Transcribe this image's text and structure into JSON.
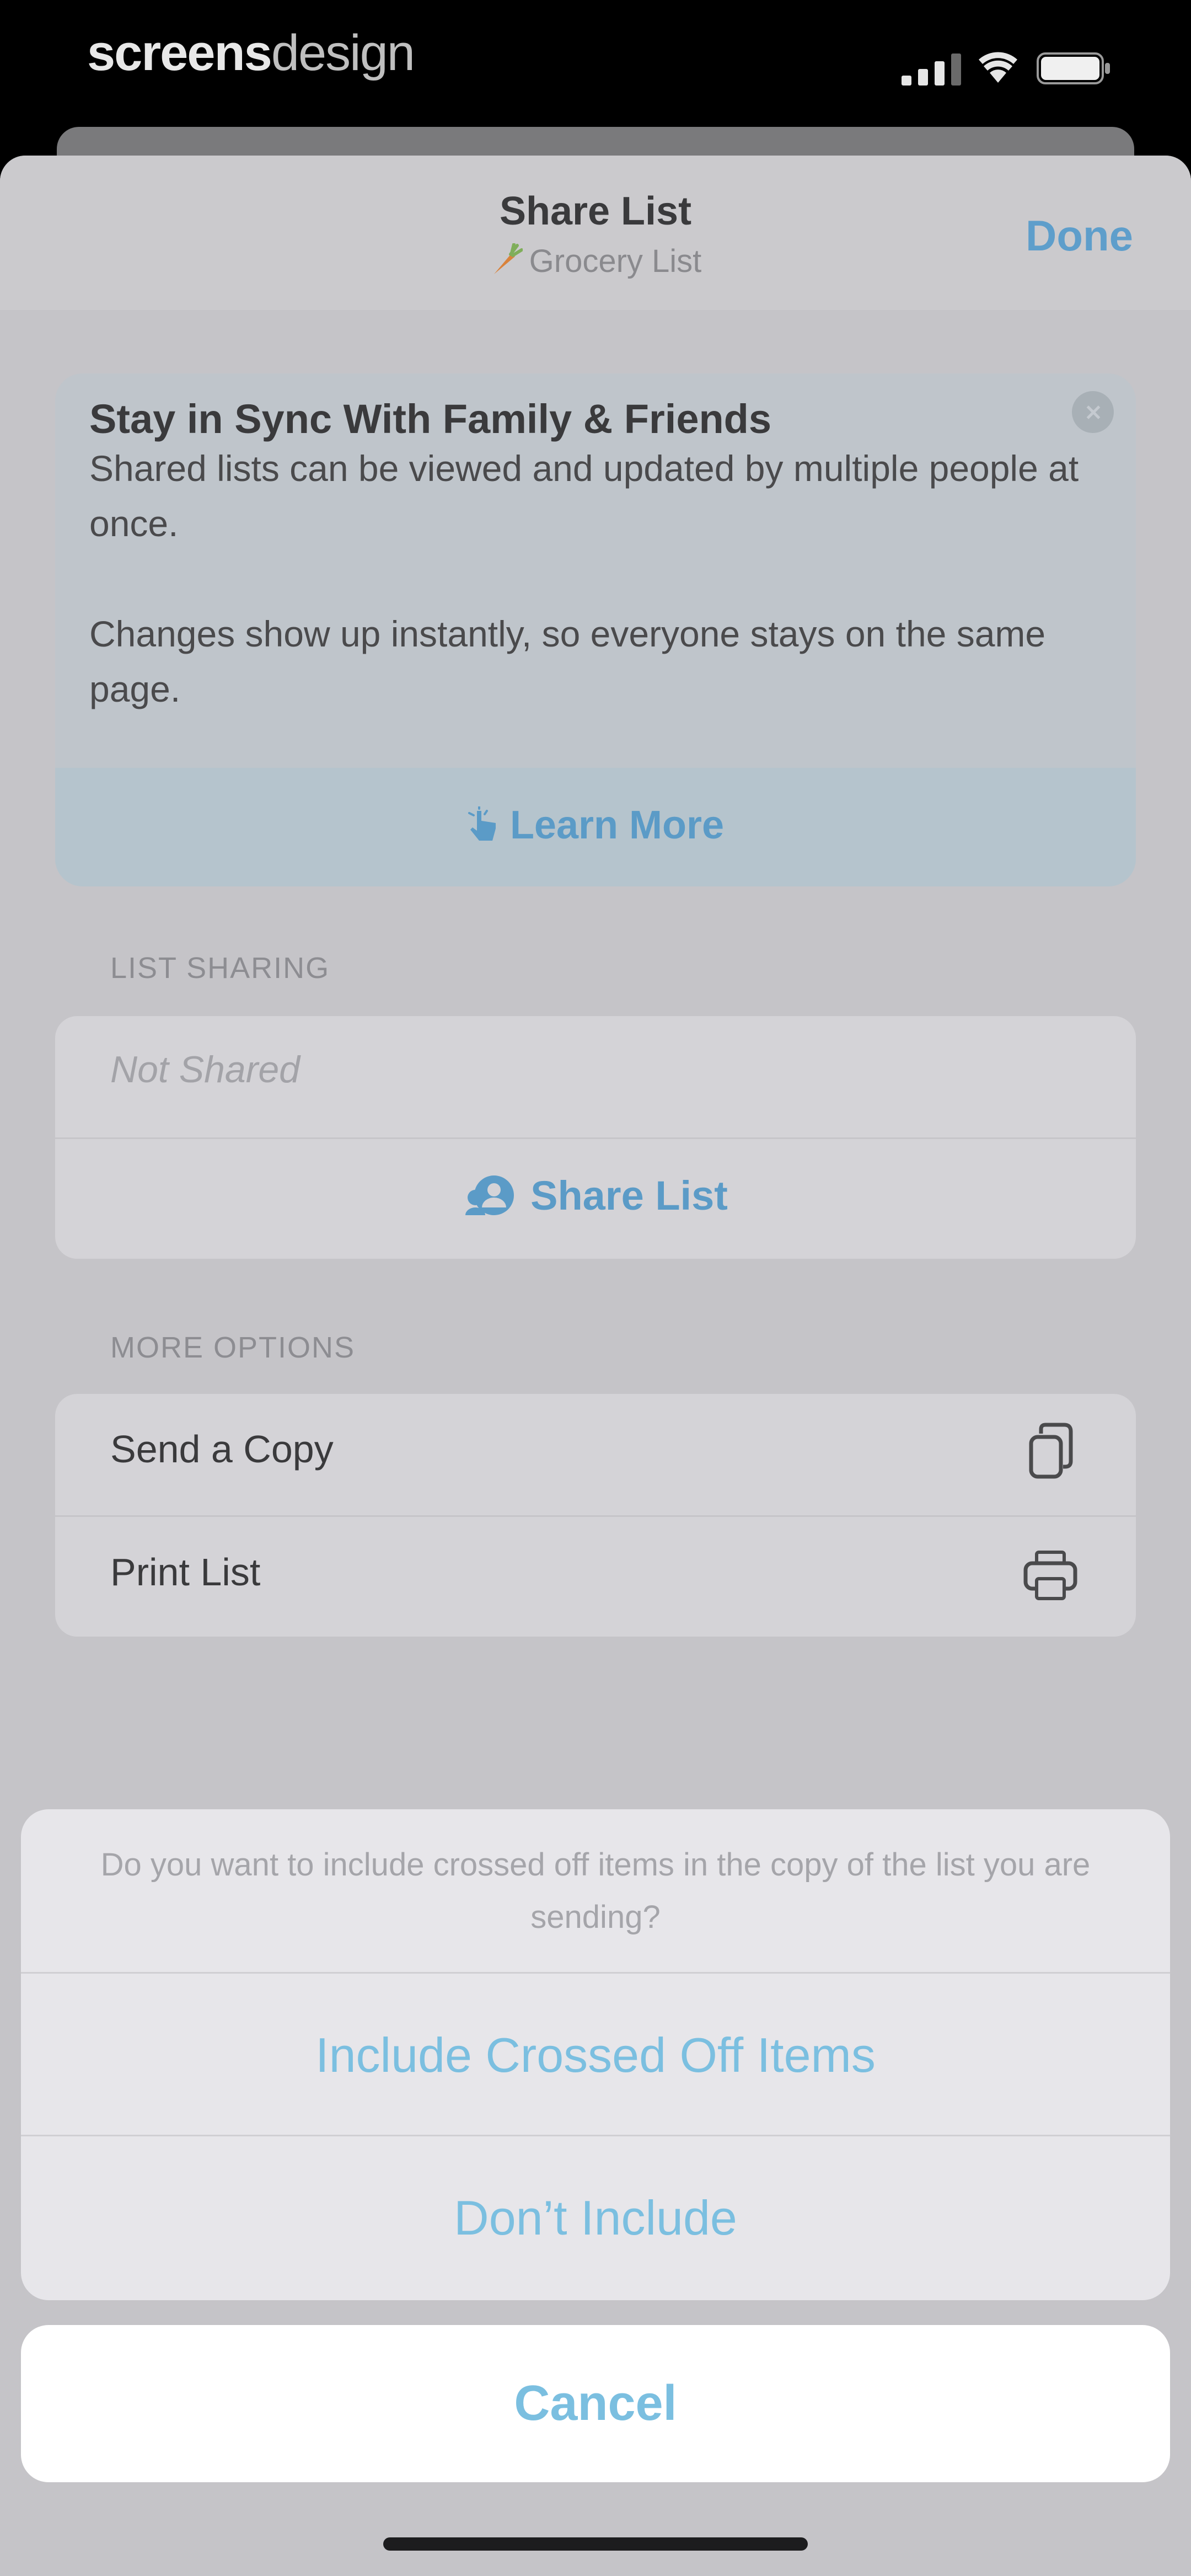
{
  "status_bar": {
    "brand_bold": "screens",
    "brand_thin": "design"
  },
  "nav": {
    "title": "Share List",
    "subtitle": "Grocery List",
    "subtitle_icon": "carrot-icon",
    "done_label": "Done"
  },
  "info_card": {
    "title": "Stay in Sync With Family & Friends",
    "body_1": "Shared lists can be viewed and updated by multiple people at once.",
    "body_2": "Changes show up instantly, so everyone stays on the same page.",
    "learn_more_label": "Learn More"
  },
  "list_sharing": {
    "section_label": "LIST SHARING",
    "status_placeholder": "Not Shared",
    "share_button_label": "Share List"
  },
  "more_options": {
    "section_label": "MORE OPTIONS",
    "items": [
      {
        "label": "Send a Copy",
        "icon": "copy-icon"
      },
      {
        "label": "Print List",
        "icon": "printer-icon"
      }
    ]
  },
  "action_sheet": {
    "message": "Do you want to include crossed off items in the copy of the list you are sending?",
    "include_label": "Include Crossed Off Items",
    "dont_include_label": "Don’t Include",
    "cancel_label": "Cancel"
  },
  "colors": {
    "accent": "#5b9bc7",
    "action_text": "#7bbfe0"
  }
}
